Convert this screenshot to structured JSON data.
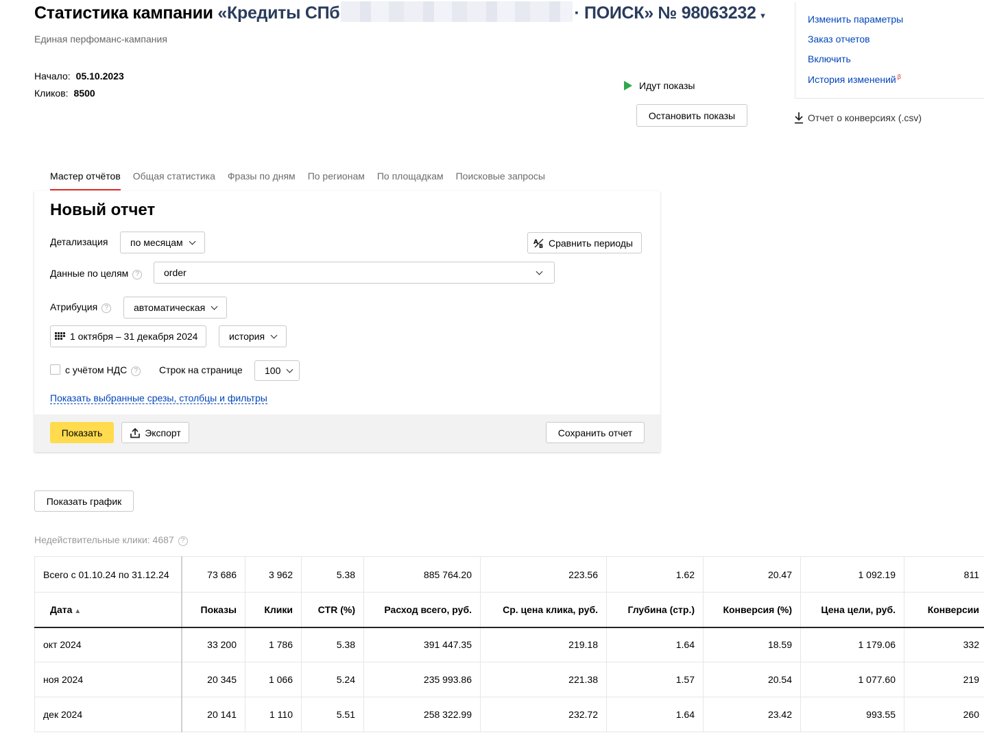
{
  "header": {
    "title_prefix": "Статистика кампании",
    "campaign_name_start": "«Кредиты СПб",
    "campaign_name_end": "· ПОИСК» № 98063232",
    "caret": "▾",
    "subtitle": "Единая перфоманс-кампания",
    "start_label": "Начало:",
    "start_value": "05.10.2023",
    "clicks_label": "Кликов:",
    "clicks_value": "8500"
  },
  "status": {
    "text": "Идут показы",
    "stop_button": "Остановить показы",
    "color": "#2ea84c"
  },
  "sidebar_links": [
    "Изменить параметры",
    "Заказ отчетов",
    "Включить",
    "История изменений"
  ],
  "beta": "β",
  "csv_link": "Отчет о конверсиях (.csv)",
  "tabs": [
    "Мастер отчётов",
    "Общая статистика",
    "Фразы по дням",
    "По регионам",
    "По площадкам",
    "Поисковые запросы"
  ],
  "report": {
    "title": "Новый отчет",
    "detail_label": "Детализация",
    "detail_value": "по месяцам",
    "compare_button": "Сравнить периоды",
    "goals_label": "Данные по целям",
    "goals_value": "order",
    "attribution_label": "Атрибуция",
    "attribution_value": "автоматическая",
    "date_range": "1 октября – 31 декабря 2024",
    "period_preset": "история",
    "vat_label": "с учётом НДС",
    "rows_label": "Строк на странице",
    "rows_value": "100",
    "show_filters_link": "Показать выбранные срезы, столбцы и фильтры",
    "show_button": "Показать",
    "export_button": "Экспорт",
    "save_button": "Сохранить отчет"
  },
  "show_chart_button": "Показать график",
  "invalid_clicks": "Недействительные клики: 4687",
  "table": {
    "total_row": [
      "Всего с 01.10.24 по 31.12.24",
      "73 686",
      "3 962",
      "5.38",
      "885 764.20",
      "223.56",
      "1.62",
      "20.47",
      "1 092.19",
      "811"
    ],
    "headers": [
      "Дата",
      "Показы",
      "Клики",
      "CTR (%)",
      "Расход всего, руб.",
      "Ср. цена клика, руб.",
      "Глубина (стр.)",
      "Конверсия (%)",
      "Цена цели, руб.",
      "Конверсии"
    ],
    "sort_indicator": "▲",
    "rows": [
      [
        "окт 2024",
        "33 200",
        "1 786",
        "5.38",
        "391 447.35",
        "219.18",
        "1.64",
        "18.59",
        "1 179.06",
        "332"
      ],
      [
        "ноя 2024",
        "20 345",
        "1 066",
        "5.24",
        "235 993.86",
        "221.38",
        "1.57",
        "20.54",
        "1 077.60",
        "219"
      ],
      [
        "дек 2024",
        "20 141",
        "1 110",
        "5.51",
        "258 322.99",
        "232.72",
        "1.64",
        "23.42",
        "993.55",
        "260"
      ]
    ]
  }
}
